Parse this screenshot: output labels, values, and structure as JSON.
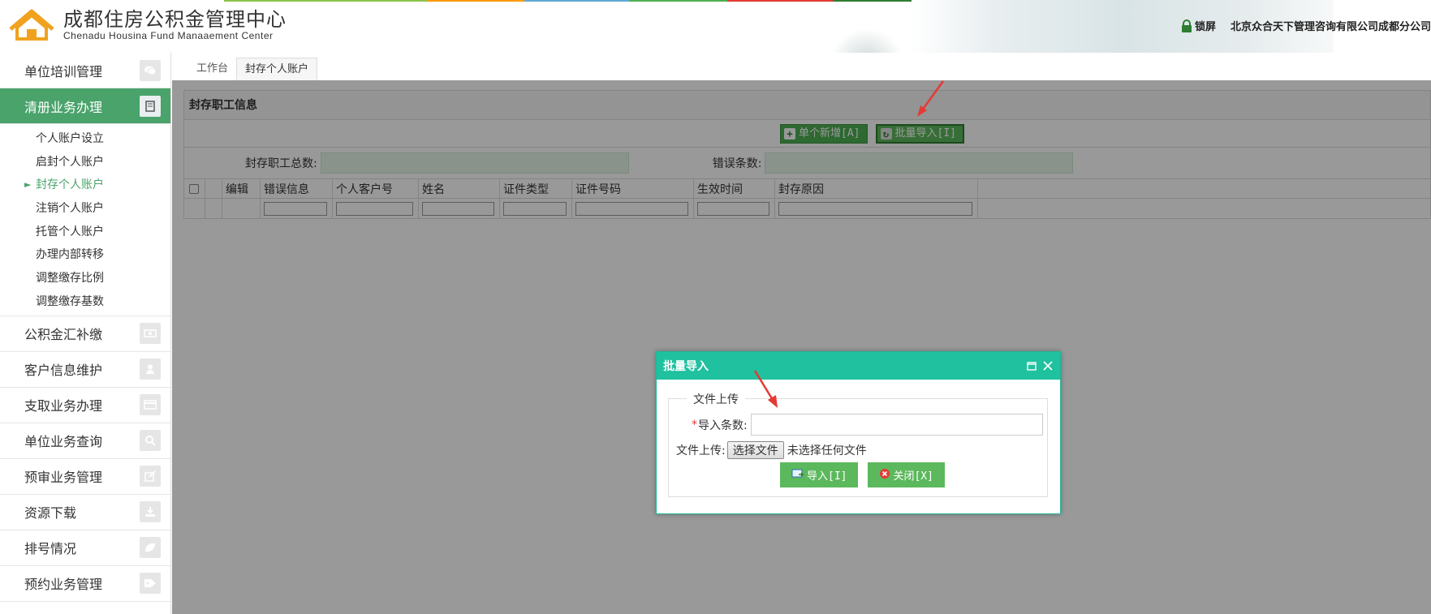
{
  "header": {
    "title_cn": "成都住房公积金管理中心",
    "title_en": "Chenadu  Housina Fund Manaaement Center",
    "lock_label": "锁屏",
    "company": "北京众合天下管理咨询有限公司成都分公司"
  },
  "sidebar": {
    "items": [
      {
        "label": "单位培训管理",
        "icon": "chat-icon"
      },
      {
        "label": "清册业务办理",
        "icon": "book-icon"
      },
      {
        "label": "公积金汇补缴",
        "icon": "money-icon"
      },
      {
        "label": "客户信息维护",
        "icon": "user-icon"
      },
      {
        "label": "支取业务办理",
        "icon": "card-icon"
      },
      {
        "label": "单位业务查询",
        "icon": "search-icon"
      },
      {
        "label": "预审业务管理",
        "icon": "edit-icon"
      },
      {
        "label": "资源下载",
        "icon": "download-icon"
      },
      {
        "label": "排号情况",
        "icon": "leaf-icon"
      },
      {
        "label": "预约业务管理",
        "icon": "tag-icon"
      }
    ],
    "subitems": [
      "个人账户设立",
      "启封个人账户",
      "封存个人账户",
      "注销个人账户",
      "托管个人账户",
      "办理内部转移",
      "调整缴存比例",
      "调整缴存基数"
    ]
  },
  "tabs": [
    "工作台",
    "封存个人账户"
  ],
  "panel": {
    "title": "封存职工信息",
    "add_button": "单个新增[A]",
    "import_button": "批量导入[I]",
    "total_label": "封存职工总数:",
    "error_label": "错误条数:",
    "columns": [
      "编辑",
      "错误信息",
      "个人客户号",
      "姓名",
      "证件类型",
      "证件号码",
      "生效时间",
      "封存原因"
    ]
  },
  "dialog": {
    "title": "批量导入",
    "legend": "文件上传",
    "count_label": "导入条数:",
    "file_label": "文件上传:",
    "file_button": "选择文件",
    "file_none": "未选择任何文件",
    "import_label": "导入[I]",
    "close_label": "关闭[X]"
  },
  "colors": {
    "accent": "#4aa36b",
    "dialog_header": "#20c19e",
    "button": "#5cb85c",
    "arrow": "#e53935"
  }
}
